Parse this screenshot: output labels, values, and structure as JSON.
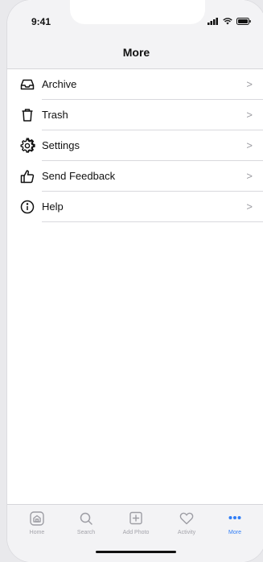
{
  "status_bar": {
    "time": "9:41"
  },
  "nav": {
    "title": "More"
  },
  "menu": {
    "items": [
      {
        "label": "Archive",
        "icon": "archive-icon"
      },
      {
        "label": "Trash",
        "icon": "trash-icon"
      },
      {
        "label": "Settings",
        "icon": "gear-icon"
      },
      {
        "label": "Send Feedback",
        "icon": "thumbs-up-icon"
      },
      {
        "label": "Help",
        "icon": "info-icon"
      }
    ],
    "chevron": ">"
  },
  "tab_bar": {
    "tabs": [
      {
        "label": "Home",
        "icon": "home-icon",
        "active": false
      },
      {
        "label": "Search",
        "icon": "search-icon",
        "active": false
      },
      {
        "label": "Add Photo",
        "icon": "add-photo-icon",
        "active": false
      },
      {
        "label": "Activity",
        "icon": "heart-icon",
        "active": false
      },
      {
        "label": "More",
        "icon": "more-icon",
        "active": true
      }
    ]
  },
  "colors": {
    "accent": "#2f7df6",
    "inactive": "#a3a3aa",
    "bar_bg": "#f3f3f5"
  }
}
